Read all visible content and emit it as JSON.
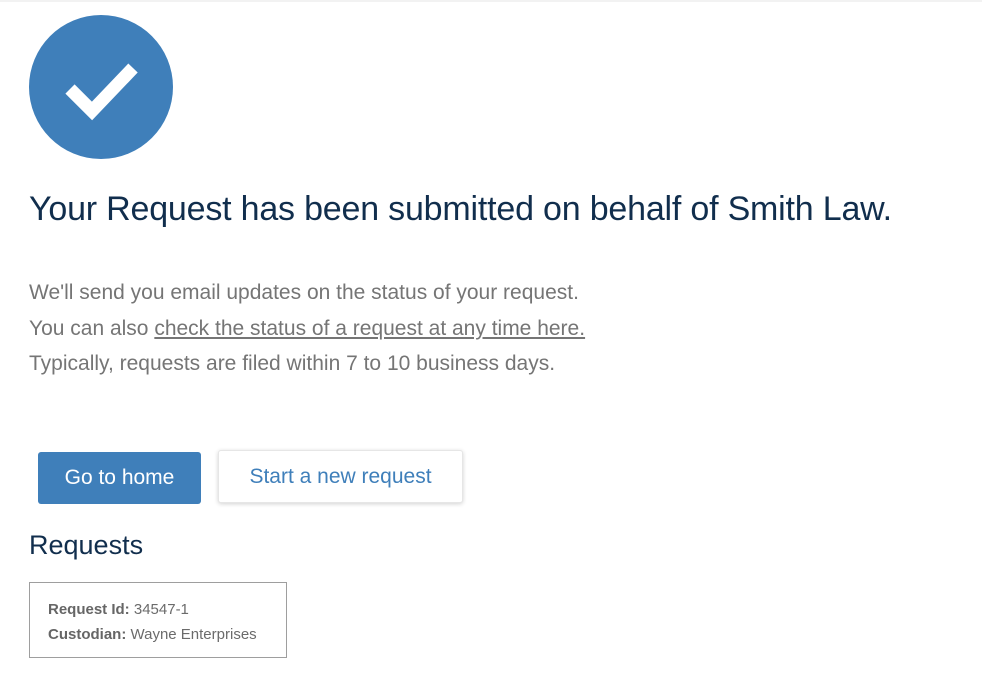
{
  "success_icon": "check-circle-icon",
  "colors": {
    "accent": "#3f7fba",
    "heading": "#112e4d",
    "body_text": "#757575"
  },
  "confirmation": {
    "title": "Your Request has been submitted on behalf of Smith Law.",
    "line1": "We'll send you email updates on the status of your request.",
    "line2_prefix": "You can also ",
    "line2_link": "check the status of a request at any time here.",
    "line3": "Typically, requests are filed within 7 to 10 business days."
  },
  "actions": {
    "home_label": "Go to home",
    "new_request_label": "Start a new request"
  },
  "requests": {
    "heading": "Requests",
    "items": [
      {
        "id_label": "Request Id:",
        "id_value": " 34547-1",
        "custodian_label": "Custodian:",
        "custodian_value": " Wayne Enterprises"
      }
    ]
  }
}
